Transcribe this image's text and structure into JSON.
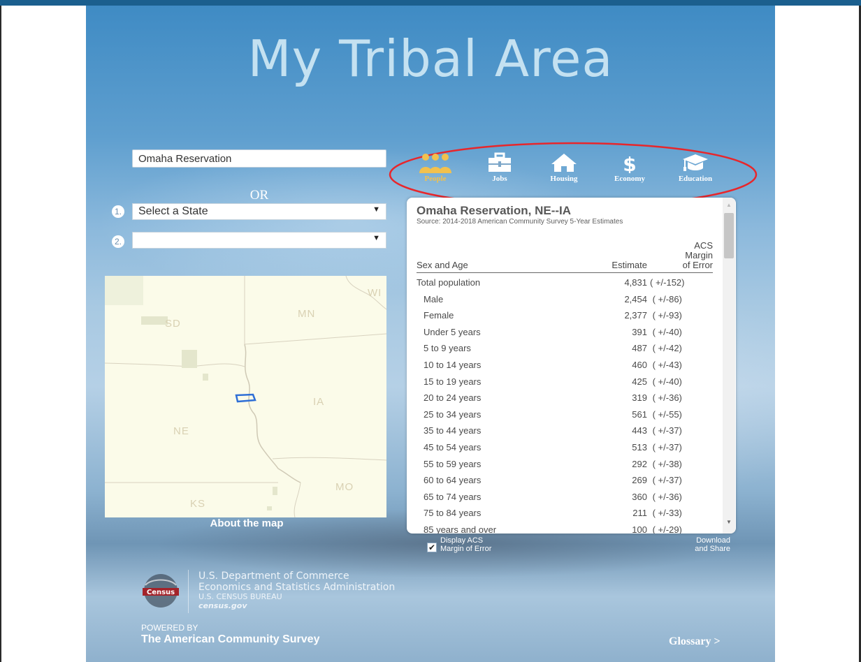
{
  "app": {
    "title": "My Tribal Area"
  },
  "search": {
    "value": "Omaha Reservation"
  },
  "or_label": "OR",
  "steps": {
    "one": "1.",
    "two": "2."
  },
  "state_select": {
    "value": "Select a State"
  },
  "area_select": {
    "value": ""
  },
  "map": {
    "labels": {
      "wi": "WI",
      "mn": "MN",
      "sd": "SD",
      "ia": "IA",
      "ne": "NE",
      "mo": "MO",
      "ks": "KS"
    },
    "about_label": "About the map"
  },
  "topics": {
    "active": "People",
    "items": [
      {
        "label": "People",
        "icon": "people-icon"
      },
      {
        "label": "Jobs",
        "icon": "briefcase-icon"
      },
      {
        "label": "Housing",
        "icon": "house-icon"
      },
      {
        "label": "Economy",
        "icon": "dollar-icon"
      },
      {
        "label": "Education",
        "icon": "graduation-cap-icon"
      }
    ],
    "highlight_color": "#e8262b",
    "active_color": "#f2c14e"
  },
  "table": {
    "title": "Omaha Reservation, NE--IA",
    "source": "Source: 2014-2018 American Community Survey 5-Year Estimates",
    "headers": {
      "label": "Sex and Age",
      "estimate": "Estimate",
      "moe_l1": "ACS",
      "moe_l2": "Margin",
      "moe_l3": "of Error"
    },
    "rows": [
      {
        "label": "Total population",
        "estimate": "4,831",
        "moe": "( +/-152)"
      },
      {
        "label": "Male",
        "estimate": "2,454",
        "moe": " ( +/-86)"
      },
      {
        "label": "Female",
        "estimate": "2,377",
        "moe": " ( +/-93)"
      },
      {
        "label": "Under 5 years",
        "estimate": "391",
        "moe": " ( +/-40)"
      },
      {
        "label": "5 to 9 years",
        "estimate": "487",
        "moe": " ( +/-42)"
      },
      {
        "label": "10 to 14 years",
        "estimate": "460",
        "moe": " ( +/-43)"
      },
      {
        "label": "15 to 19 years",
        "estimate": "425",
        "moe": " ( +/-40)"
      },
      {
        "label": "20 to 24 years",
        "estimate": "319",
        "moe": " ( +/-36)"
      },
      {
        "label": "25 to 34 years",
        "estimate": "561",
        "moe": " ( +/-55)"
      },
      {
        "label": "35 to 44 years",
        "estimate": "443",
        "moe": " ( +/-37)"
      },
      {
        "label": "45 to 54 years",
        "estimate": "513",
        "moe": " ( +/-37)"
      },
      {
        "label": "55 to 59 years",
        "estimate": "292",
        "moe": " ( +/-38)"
      },
      {
        "label": "60 to 64 years",
        "estimate": "269",
        "moe": " ( +/-37)"
      },
      {
        "label": "65 to 74 years",
        "estimate": "360",
        "moe": " ( +/-36)"
      },
      {
        "label": "75 to 84 years",
        "estimate": "211",
        "moe": " ( +/-33)"
      },
      {
        "label": "85 years and over",
        "estimate": "100",
        "moe": " ( +/-29)"
      }
    ]
  },
  "options": {
    "moe_checkbox_checked": true,
    "moe_checkbox_label_l1": "Display ACS",
    "moe_checkbox_label_l2": "Margin of Error",
    "download_l1": "Download",
    "download_l2": "and Share"
  },
  "footer": {
    "logo_text": "Census",
    "dept_l1": "U.S. Department of Commerce",
    "dept_l2": "Economics and Statistics Administration",
    "dept_l3": "U.S. CENSUS BUREAU",
    "dept_l4": "census.gov",
    "powered_by": "POWERED BY",
    "acs": "The American Community Survey",
    "glossary": "Glossary >"
  },
  "colors": {
    "top_bar": "#1b5f8e",
    "title": "#c4e1f1",
    "map_bg": "#fbfbe9",
    "reservation_outline": "#2f6fd6"
  }
}
